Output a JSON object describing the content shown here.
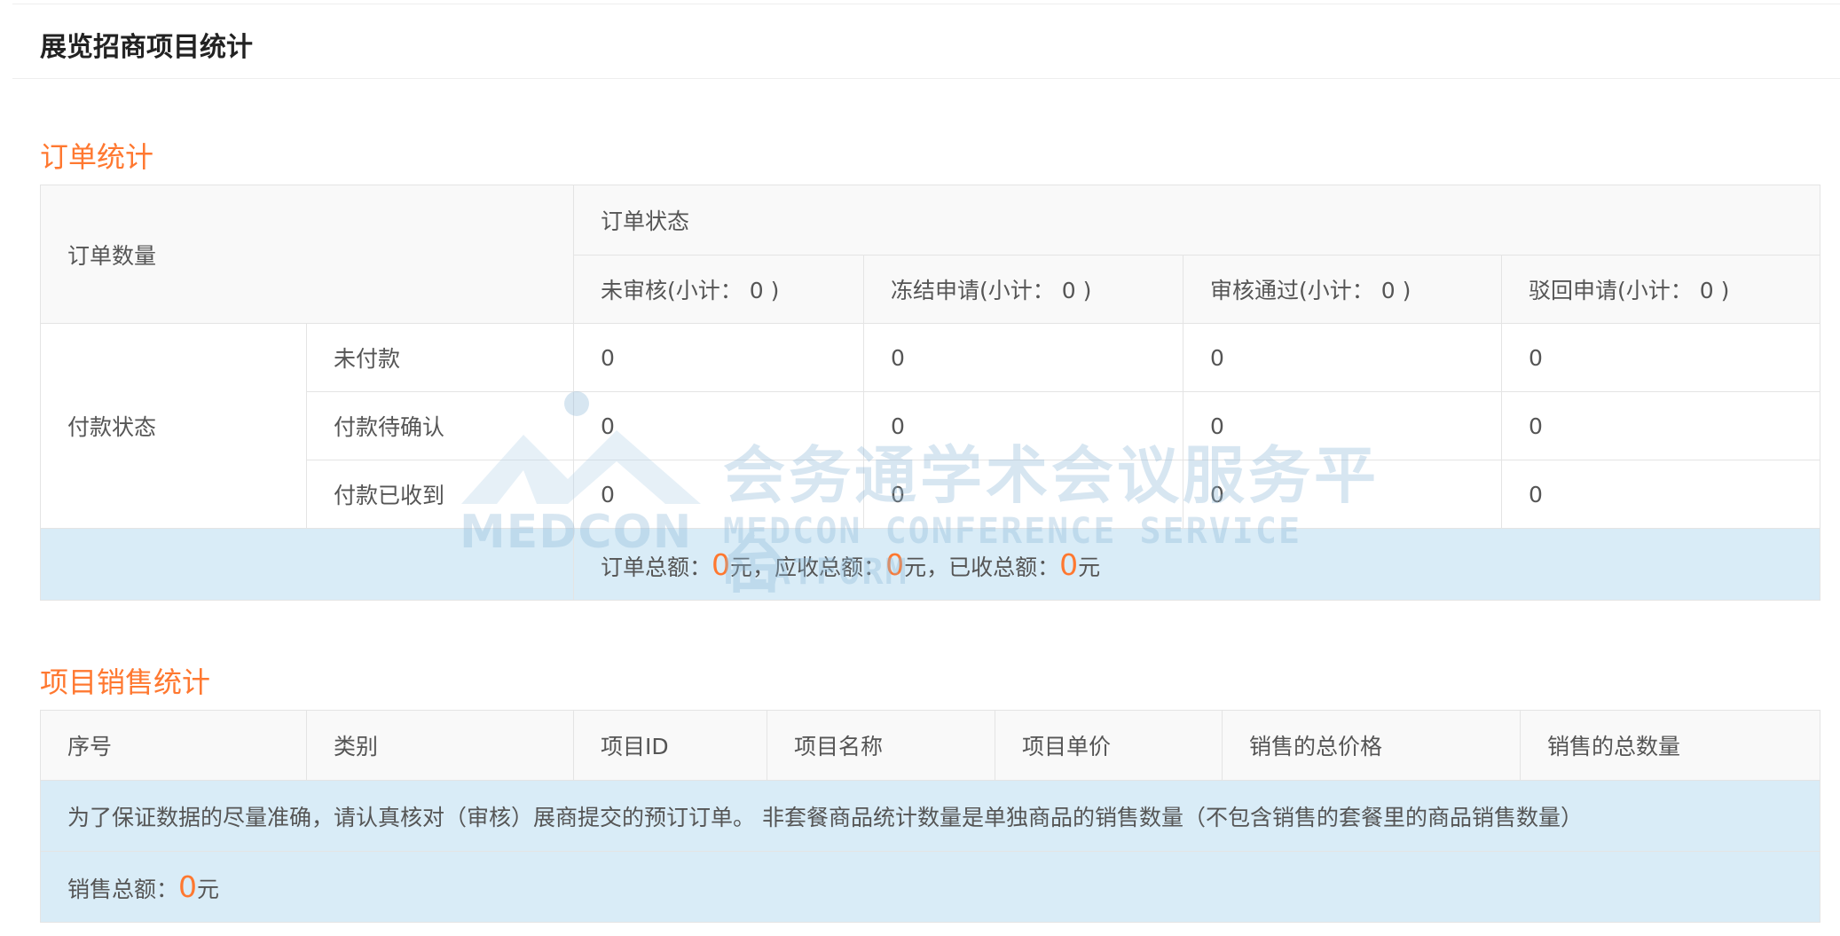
{
  "page_title": "展览招商项目统计",
  "order_section": {
    "title": "订单统计",
    "order_count_label": "订单数量",
    "order_status_label": "订单状态",
    "status_columns": [
      "未审核(小计： 0 )",
      "冻结申请(小计： 0 )",
      "审核通过(小计： 0 )",
      "驳回申请(小计： 0 )"
    ],
    "payment_status_label": "付款状态",
    "payment_rows": [
      {
        "label": "未付款",
        "values": [
          "0",
          "0",
          "0",
          "0"
        ]
      },
      {
        "label": "付款待确认",
        "values": [
          "0",
          "0",
          "0",
          "0"
        ]
      },
      {
        "label": "付款已收到",
        "values": [
          "0",
          "0",
          "0",
          "0"
        ]
      }
    ],
    "totals": {
      "order_total_label": "订单总额：",
      "order_total_value": "0",
      "order_total_unit": "元，",
      "receivable_label": "应收总额：",
      "receivable_value": "0",
      "receivable_unit": "元，",
      "received_label": "已收总额：",
      "received_value": "0",
      "received_unit": "元"
    }
  },
  "sales_section": {
    "title": "项目销售统计",
    "columns": [
      "序号",
      "类别",
      "项目ID",
      "项目名称",
      "项目单价",
      "销售的总价格",
      "销售的总数量"
    ],
    "note": "为了保证数据的尽量准确，请认真核对（审核）展商提交的预订订单。 非套餐商品统计数量是单独商品的销售数量（不包含销售的套餐里的商品销售数量）",
    "sales_total_label": "销售总额：",
    "sales_total_value": "0",
    "sales_total_unit": "元"
  },
  "watermark": {
    "logo_text": "MEDCON",
    "cn_text": "会务通学术会议服务平台",
    "en_text": "MEDCON CONFERENCE SERVICE PLATFORM"
  },
  "colors": {
    "accent": "#ff7830",
    "highlight_row": "#d9ecf7",
    "header_bg": "#f9f9f9"
  }
}
